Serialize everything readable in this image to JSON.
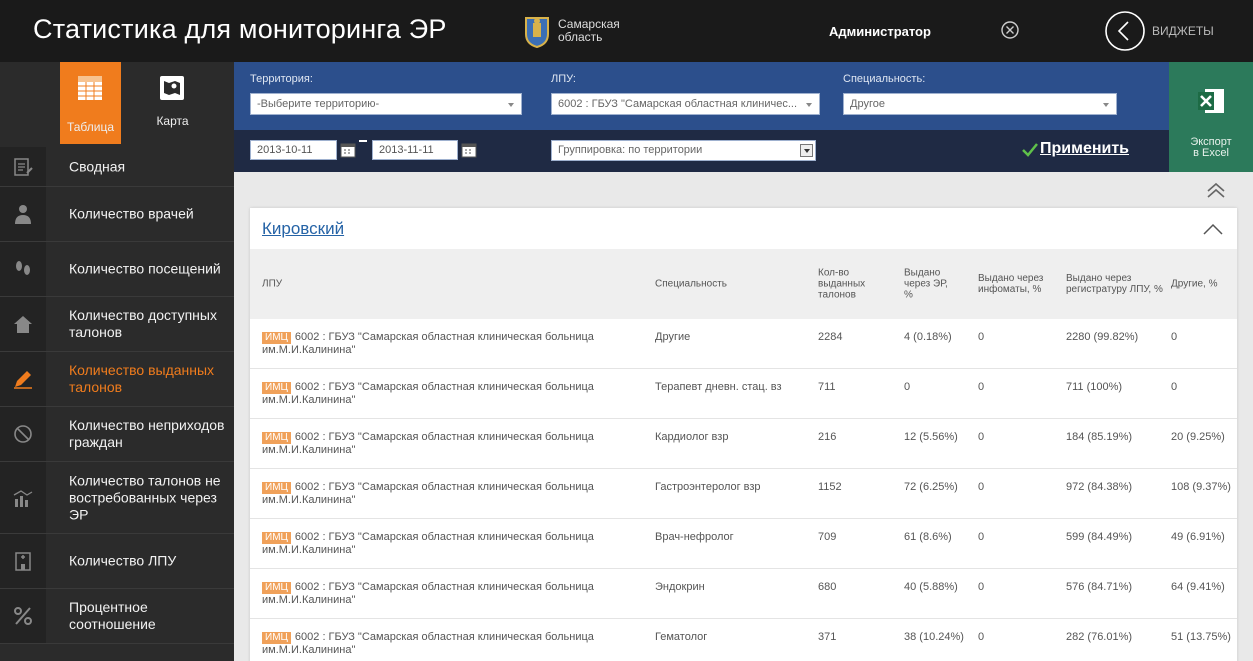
{
  "header": {
    "title": "Статистика для мониторинга ЭР",
    "region_line1": "Самарская",
    "region_line2": "область",
    "user": "Администратор",
    "widgets": "ВИДЖЕТЫ"
  },
  "view_tabs": [
    {
      "label": "Таблица",
      "active": true
    },
    {
      "label": "Карта",
      "active": false
    }
  ],
  "nav": [
    {
      "label": "Сводная",
      "icon": "summary-icon"
    },
    {
      "label": "Количество врачей",
      "icon": "doctor-icon"
    },
    {
      "label": "Количество посещений",
      "icon": "footprints-icon"
    },
    {
      "label": "Количество доступных талонов",
      "icon": "house-icon"
    },
    {
      "label": "Количество выданных талонов",
      "icon": "pencil-icon",
      "active": true
    },
    {
      "label": "Количество неприходов граждан",
      "icon": "no-show-icon"
    },
    {
      "label": "Количество талонов не востребованных через ЭР",
      "icon": "chart-icon"
    },
    {
      "label": "Количество ЛПУ",
      "icon": "building-icon"
    },
    {
      "label": "Процентное соотношение",
      "icon": "percent-icon"
    }
  ],
  "filters": {
    "territory_label": "Территория:",
    "territory_value": "-Выберите территорию-",
    "lpu_label": "ЛПУ:",
    "lpu_value": "6002 : ГБУЗ \"Самарская областная клиничес...",
    "specialty_label": "Специальность:",
    "specialty_value": "Другое",
    "date_from": "2013-10-11",
    "date_to": "2013-11-11",
    "grouping": "Группировка: по территории",
    "apply": "Применить"
  },
  "excel": {
    "line1": "Экспорт",
    "line2": "в Excel"
  },
  "panel": {
    "title": "Кировский",
    "columns": {
      "lpu": "ЛПУ",
      "specialty": "Специальность",
      "issued": "Кол-во выданных талонов",
      "via_er": "Выдано через ЭР, %",
      "via_kiosk": "Выдано через инфоматы, %",
      "via_registry": "Выдано через регистратуру ЛПУ, %",
      "other": "Другие, %"
    },
    "rows": [
      {
        "badge": "ИМЦ",
        "lpu": "6002 : ГБУЗ \"Самарская областная клиническая больница им.М.И.Калинина\"",
        "specialty": "Другие",
        "issued": "2284",
        "via_er": "4 (0.18%)",
        "via_kiosk": "0",
        "via_registry": "2280 (99.82%)",
        "other": "0"
      },
      {
        "badge": "ИМЦ",
        "lpu": "6002 : ГБУЗ \"Самарская областная клиническая больница им.М.И.Калинина\"",
        "specialty": "Терапевт дневн. стац. вз",
        "issued": "711",
        "via_er": "0",
        "via_kiosk": "0",
        "via_registry": "711 (100%)",
        "other": "0"
      },
      {
        "badge": "ИМЦ",
        "lpu": "6002 : ГБУЗ \"Самарская областная клиническая больница им.М.И.Калинина\"",
        "specialty": "Кардиолог взр",
        "issued": "216",
        "via_er": "12 (5.56%)",
        "via_kiosk": "0",
        "via_registry": "184 (85.19%)",
        "other": "20 (9.25%)"
      },
      {
        "badge": "ИМЦ",
        "lpu": "6002 : ГБУЗ \"Самарская областная клиническая больница им.М.И.Калинина\"",
        "specialty": "Гастроэнтеролог взр",
        "issued": "1152",
        "via_er": "72 (6.25%)",
        "via_kiosk": "0",
        "via_registry": "972 (84.38%)",
        "other": "108 (9.37%)"
      },
      {
        "badge": "ИМЦ",
        "lpu": "6002 : ГБУЗ \"Самарская областная клиническая больница им.М.И.Калинина\"",
        "specialty": "Врач-нефролог",
        "issued": "709",
        "via_er": "61 (8.6%)",
        "via_kiosk": "0",
        "via_registry": "599 (84.49%)",
        "other": "49 (6.91%)"
      },
      {
        "badge": "ИМЦ",
        "lpu": "6002 : ГБУЗ \"Самарская областная клиническая больница им.М.И.Калинина\"",
        "specialty": "Эндокрин",
        "issued": "680",
        "via_er": "40 (5.88%)",
        "via_kiosk": "0",
        "via_registry": "576 (84.71%)",
        "other": "64 (9.41%)"
      },
      {
        "badge": "ИМЦ",
        "lpu": "6002 : ГБУЗ \"Самарская областная клиническая больница им.М.И.Калинина\"",
        "specialty": "Гематолог",
        "issued": "371",
        "via_er": "38 (10.24%)",
        "via_kiosk": "0",
        "via_registry": "282 (76.01%)",
        "other": "51 (13.75%)"
      }
    ]
  },
  "colors": {
    "accent": "#f07c1d",
    "filter_bar": "#2c4f8c",
    "excel": "#2c7a5b",
    "link": "#2563a6"
  }
}
